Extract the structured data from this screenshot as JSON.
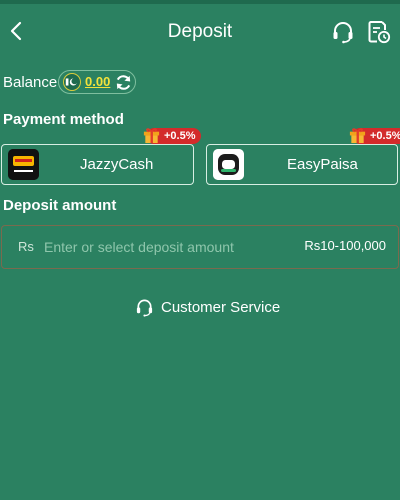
{
  "header": {
    "title": "Deposit",
    "icons": {
      "back": "back-chevron-icon",
      "support": "headset-icon",
      "history": "history-clock-icon"
    }
  },
  "balance": {
    "label": "Balance",
    "value": "0.00",
    "icons": {
      "currency": "pakistan-flag-coin-icon",
      "refresh": "refresh-icon"
    }
  },
  "payment_method": {
    "title": "Payment method",
    "options": [
      {
        "name": "JazzyCash",
        "bonus": "+0.5%",
        "logo_icon": "jazzcash-logo-icon"
      },
      {
        "name": "EasyPaisa",
        "bonus": "+0.5%",
        "logo_icon": "easypaisa-logo-icon"
      }
    ]
  },
  "deposit_amount": {
    "title": "Deposit amount",
    "currency_symbol": "Rs",
    "placeholder": "Enter or select deposit amount",
    "range": "Rs10-100,000"
  },
  "customer_service": {
    "label": "Customer Service",
    "icon": "headset-icon"
  },
  "colors": {
    "background": "#2b8161",
    "balance_value": "#f3e23b",
    "badge": "#d32b2b",
    "input_border": "#7a6a4e"
  }
}
